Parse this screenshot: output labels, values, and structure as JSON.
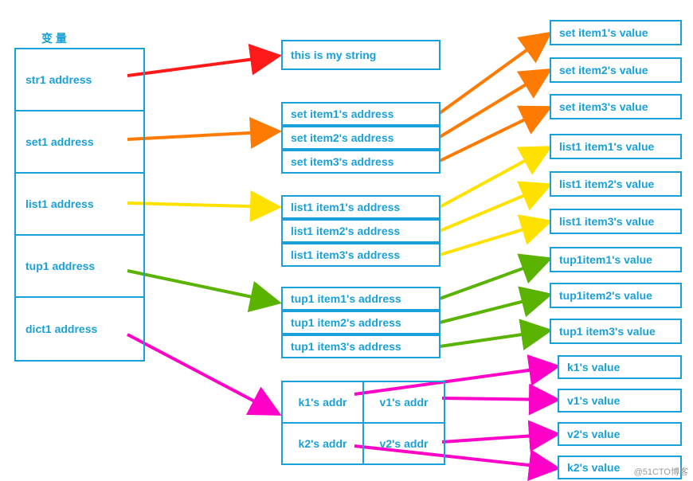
{
  "header": {
    "title": "变 量"
  },
  "vars": {
    "str1": "str1 address",
    "set1": "set1 address",
    "list1": "list1 address",
    "tup1": "tup1 address",
    "dict1": "dict1 address"
  },
  "mid": {
    "str": "this is my string",
    "set": [
      "set item1's address",
      "set item2's address",
      "set item3's address"
    ],
    "list": [
      "list1 item1's address",
      "list1  item2's address",
      "list1  item3's address"
    ],
    "tup": [
      "tup1  item1's address",
      "tup1  item2's address",
      "tup1  item3's address"
    ],
    "dict": {
      "k1": "k1's addr",
      "v1": "v1's addr",
      "k2": "k2's addr",
      "v2": "v2's addr"
    }
  },
  "right": {
    "set": [
      "set item1's value",
      "set item2's value",
      "set item3's value"
    ],
    "list": [
      "list1 item1's value",
      "list1 item2's value",
      "list1 item3's value"
    ],
    "tup": [
      "tup1item1's value",
      "tup1item2's value",
      "tup1 item3's value"
    ],
    "dict": [
      "k1's    value",
      "v1's    value",
      "v2's    value",
      "k2's    value"
    ]
  },
  "watermark": "@51CTO博客",
  "colors": {
    "border": "#1aa0d8",
    "red": "#ff1a1a",
    "orange": "#ff7a00",
    "yellow": "#ffe100",
    "green": "#5ab300",
    "magenta": "#ff00c8"
  }
}
